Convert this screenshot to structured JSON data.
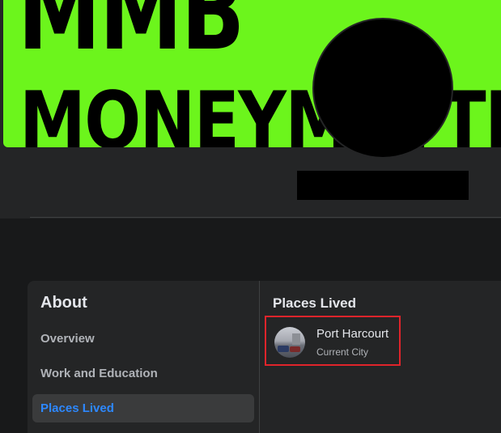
{
  "cover": {
    "line1": "MMB",
    "line2": "MONEYMATTR"
  },
  "about": {
    "title": "About",
    "nav": [
      {
        "label": "Overview",
        "active": false
      },
      {
        "label": "Work and Education",
        "active": false
      },
      {
        "label": "Places Lived",
        "active": true
      }
    ]
  },
  "places": {
    "section_title": "Places Lived",
    "items": [
      {
        "name": "Port Harcourt",
        "type": "Current City",
        "icon": "city-photo-thumbnail"
      }
    ]
  },
  "colors": {
    "cover_green": "#6cf51c",
    "active_blue": "#2d88ff",
    "highlight_red": "#e0242b"
  }
}
